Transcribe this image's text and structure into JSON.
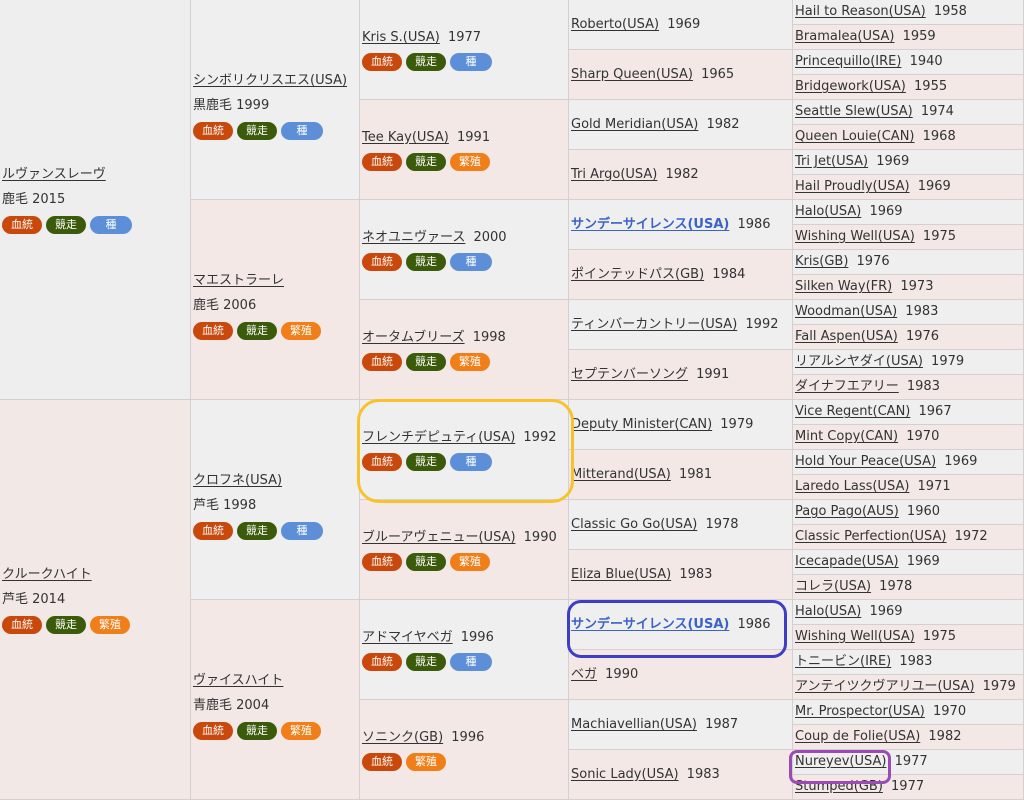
{
  "badge_labels": {
    "kettou": "血統",
    "kyousou": "競走",
    "shu": "種",
    "hanshoku": "繁殖"
  },
  "colors": {
    "kettou": "#c9490c",
    "kyousou": "#3b5a0a",
    "shu": "#5d8fd8",
    "hanshoku": "#f07f1a",
    "highlight_yellow": "#f8c22b",
    "highlight_blue": "#3e3ec4",
    "highlight_purple": "#9b4cb4"
  },
  "pedigree": [
    {
      "gen": 1,
      "name": "ルヴァンスレーヴ",
      "coat": "鹿毛 2015",
      "badges": [
        "kettou",
        "kyousou",
        "shu"
      ]
    },
    {
      "gen": 1,
      "name": "クルークハイト",
      "coat": "芦毛 2014",
      "badges": [
        "kettou",
        "kyousou",
        "hanshoku"
      ]
    },
    {
      "gen": 2,
      "name": "シンボリクリスエス(USA)",
      "coat": "黒鹿毛 1999",
      "badges": [
        "kettou",
        "kyousou",
        "shu"
      ]
    },
    {
      "gen": 2,
      "name": "マエストラーレ",
      "coat": "鹿毛 2006",
      "badges": [
        "kettou",
        "kyousou",
        "hanshoku"
      ]
    },
    {
      "gen": 2,
      "name": "クロフネ(USA)",
      "coat": "芦毛 1998",
      "badges": [
        "kettou",
        "kyousou",
        "shu"
      ]
    },
    {
      "gen": 2,
      "name": "ヴァイスハイト",
      "coat": "青鹿毛 2004",
      "badges": [
        "kettou",
        "kyousou",
        "hanshoku"
      ]
    },
    {
      "gen": 3,
      "name": "Kris S.(USA)",
      "year": "1977",
      "badges": [
        "kettou",
        "kyousou",
        "shu"
      ]
    },
    {
      "gen": 3,
      "name": "Tee Kay(USA)",
      "year": "1991",
      "badges": [
        "kettou",
        "kyousou",
        "hanshoku"
      ]
    },
    {
      "gen": 3,
      "name": "ネオユニヴァース",
      "year": "2000",
      "badges": [
        "kettou",
        "kyousou",
        "shu"
      ]
    },
    {
      "gen": 3,
      "name": "オータムブリーズ",
      "year": "1998",
      "badges": [
        "kettou",
        "kyousou",
        "hanshoku"
      ]
    },
    {
      "gen": 3,
      "name": "フレンチデピュティ(USA)",
      "year": "1992",
      "badges": [
        "kettou",
        "kyousou",
        "shu"
      ]
    },
    {
      "gen": 3,
      "name": "ブルーアヴェニュー(USA)",
      "year": "1990",
      "badges": [
        "kettou",
        "kyousou",
        "hanshoku"
      ]
    },
    {
      "gen": 3,
      "name": "アドマイヤベガ",
      "year": "1996",
      "badges": [
        "kettou",
        "kyousou",
        "shu"
      ]
    },
    {
      "gen": 3,
      "name": "ソニンク(GB)",
      "year": "1996",
      "badges": [
        "kettou",
        "hanshoku"
      ]
    },
    {
      "gen": 4,
      "name": "Roberto(USA)",
      "year": "1969"
    },
    {
      "gen": 4,
      "name": "Sharp Queen(USA)",
      "year": "1965"
    },
    {
      "gen": 4,
      "name": "Gold Meridian(USA)",
      "year": "1982"
    },
    {
      "gen": 4,
      "name": "Tri Argo(USA)",
      "year": "1982"
    },
    {
      "gen": 4,
      "name": "サンデーサイレンス(USA)",
      "year": "1986",
      "strong": true
    },
    {
      "gen": 4,
      "name": "ポインテッドパス(GB)",
      "year": "1984"
    },
    {
      "gen": 4,
      "name": "ティンバーカントリー(USA)",
      "year": "1992"
    },
    {
      "gen": 4,
      "name": "セプテンバーソング",
      "year": "1991"
    },
    {
      "gen": 4,
      "name": "Deputy Minister(CAN)",
      "year": "1979"
    },
    {
      "gen": 4,
      "name": "Mitterand(USA)",
      "year": "1981"
    },
    {
      "gen": 4,
      "name": "Classic Go Go(USA)",
      "year": "1978"
    },
    {
      "gen": 4,
      "name": "Eliza Blue(USA)",
      "year": "1983"
    },
    {
      "gen": 4,
      "name": "サンデーサイレンス(USA)",
      "year": "1986",
      "strong": true
    },
    {
      "gen": 4,
      "name": "ベガ",
      "year": "1990"
    },
    {
      "gen": 4,
      "name": "Machiavellian(USA)",
      "year": "1987"
    },
    {
      "gen": 4,
      "name": "Sonic Lady(USA)",
      "year": "1983"
    },
    {
      "gen": 5,
      "name": "Hail to Reason(USA)",
      "year": "1958"
    },
    {
      "gen": 5,
      "name": "Bramalea(USA)",
      "year": "1959"
    },
    {
      "gen": 5,
      "name": "Princequillo(IRE)",
      "year": "1940"
    },
    {
      "gen": 5,
      "name": "Bridgework(USA)",
      "year": "1955"
    },
    {
      "gen": 5,
      "name": "Seattle Slew(USA)",
      "year": "1974"
    },
    {
      "gen": 5,
      "name": "Queen Louie(CAN)",
      "year": "1968"
    },
    {
      "gen": 5,
      "name": "Tri Jet(USA)",
      "year": "1969"
    },
    {
      "gen": 5,
      "name": "Hail Proudly(USA)",
      "year": "1969"
    },
    {
      "gen": 5,
      "name": "Halo(USA)",
      "year": "1969"
    },
    {
      "gen": 5,
      "name": "Wishing Well(USA)",
      "year": "1975"
    },
    {
      "gen": 5,
      "name": "Kris(GB)",
      "year": "1976"
    },
    {
      "gen": 5,
      "name": "Silken Way(FR)",
      "year": "1973"
    },
    {
      "gen": 5,
      "name": "Woodman(USA)",
      "year": "1983"
    },
    {
      "gen": 5,
      "name": "Fall Aspen(USA)",
      "year": "1976"
    },
    {
      "gen": 5,
      "name": "リアルシヤダイ(USA)",
      "year": "1979"
    },
    {
      "gen": 5,
      "name": "ダイナフエアリー",
      "year": "1983"
    },
    {
      "gen": 5,
      "name": "Vice Regent(CAN)",
      "year": "1967"
    },
    {
      "gen": 5,
      "name": "Mint Copy(CAN)",
      "year": "1970"
    },
    {
      "gen": 5,
      "name": "Hold Your Peace(USA)",
      "year": "1969"
    },
    {
      "gen": 5,
      "name": "Laredo Lass(USA)",
      "year": "1971"
    },
    {
      "gen": 5,
      "name": "Pago Pago(AUS)",
      "year": "1960"
    },
    {
      "gen": 5,
      "name": "Classic Perfection(USA)",
      "year": "1972"
    },
    {
      "gen": 5,
      "name": "Icecapade(USA)",
      "year": "1969"
    },
    {
      "gen": 5,
      "name": "コレラ(USA)",
      "year": "1978"
    },
    {
      "gen": 5,
      "name": "Halo(USA)",
      "year": "1969"
    },
    {
      "gen": 5,
      "name": "Wishing Well(USA)",
      "year": "1975"
    },
    {
      "gen": 5,
      "name": "トニービン(IRE)",
      "year": "1983"
    },
    {
      "gen": 5,
      "name": "アンテイツクヴアリユー(USA)",
      "year": "1979"
    },
    {
      "gen": 5,
      "name": "Mr. Prospector(USA)",
      "year": "1970"
    },
    {
      "gen": 5,
      "name": "Coup de Folie(USA)",
      "year": "1982"
    },
    {
      "gen": 5,
      "name": "Nureyev(USA)",
      "year": "1977"
    },
    {
      "gen": 5,
      "name": "Stumped(GB)",
      "year": "1977"
    }
  ]
}
